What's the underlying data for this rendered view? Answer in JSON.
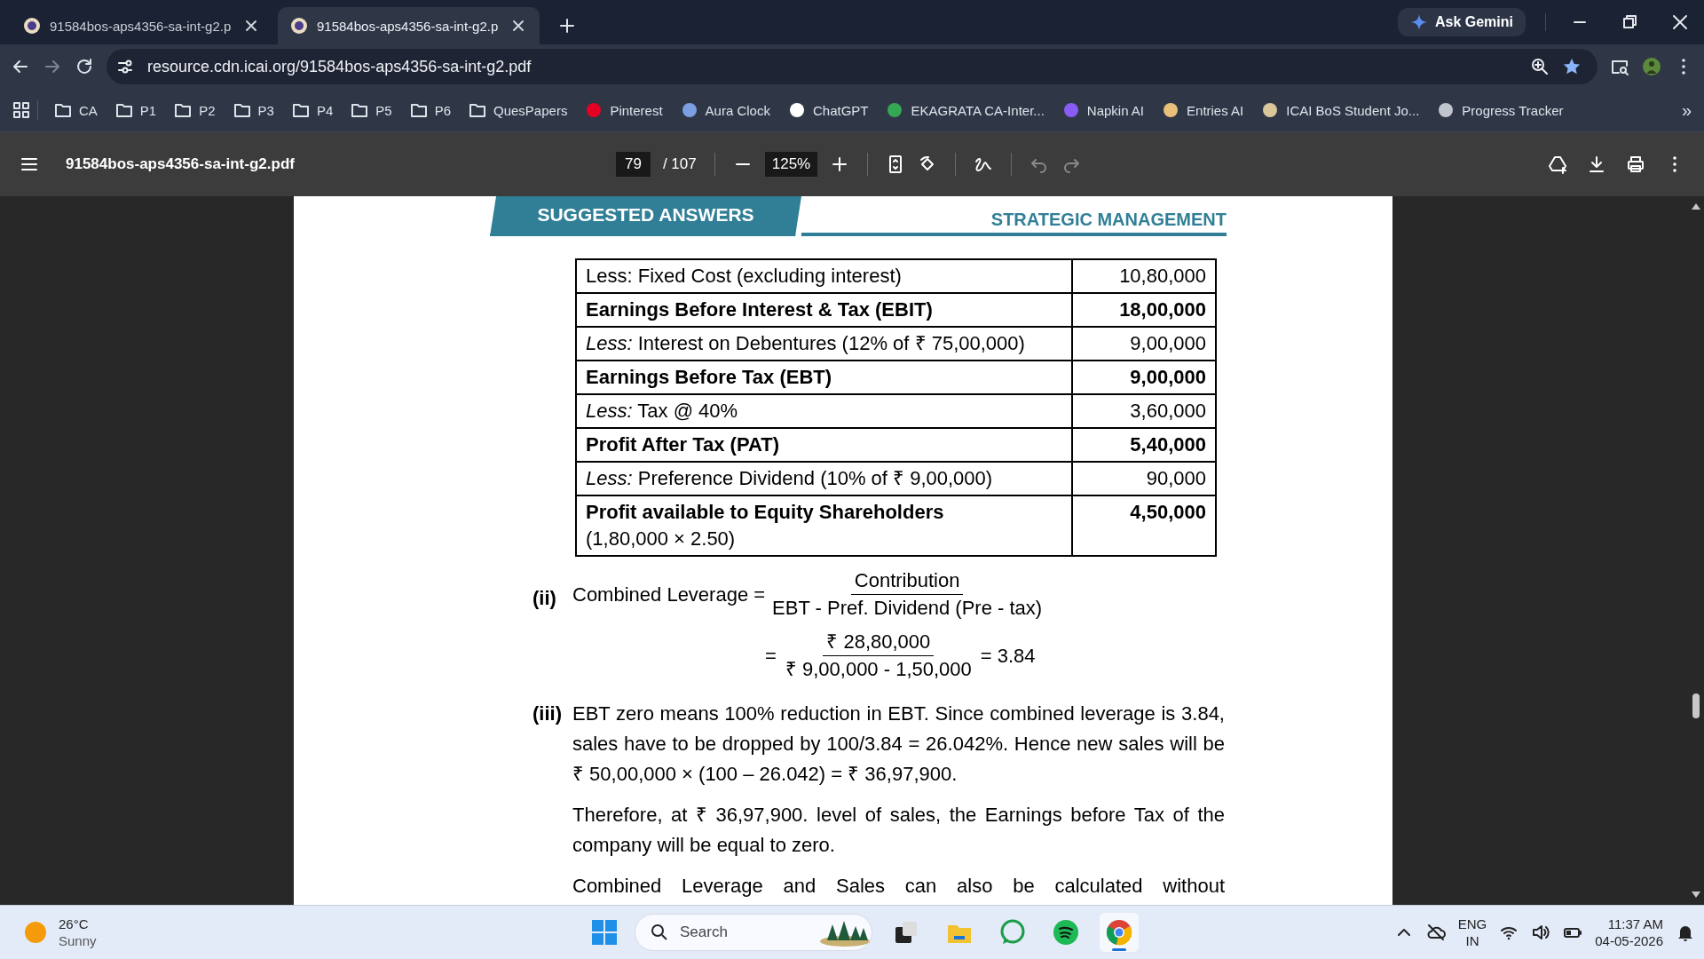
{
  "browser": {
    "tabs": [
      {
        "title": "91584bos-aps4356-sa-int-g2.p",
        "selected": false
      },
      {
        "title": "91584bos-aps4356-sa-int-g2.p",
        "selected": true
      }
    ],
    "ask_button": "Ask Gemini",
    "address": "resource.cdn.icai.org/91584bos-aps4356-sa-int-g2.pdf",
    "bookmarks": [
      {
        "kind": "folder",
        "label": "CA"
      },
      {
        "kind": "folder",
        "label": "P1"
      },
      {
        "kind": "folder",
        "label": "P2"
      },
      {
        "kind": "folder",
        "label": "P3"
      },
      {
        "kind": "folder",
        "label": "P4"
      },
      {
        "kind": "folder",
        "label": "P5"
      },
      {
        "kind": "folder",
        "label": "P6"
      },
      {
        "kind": "folder",
        "label": "QuesPapers"
      },
      {
        "kind": "site",
        "label": "Pinterest",
        "color": "#e60023"
      },
      {
        "kind": "site",
        "label": "Aura Clock",
        "color": "#7b9fe0"
      },
      {
        "kind": "site",
        "label": "ChatGPT",
        "color": "#ffffff"
      },
      {
        "kind": "site",
        "label": "EKAGRATA CA-Inter...",
        "color": "#34a853"
      },
      {
        "kind": "site",
        "label": "Napkin AI",
        "color": "#8a5cf6"
      },
      {
        "kind": "site",
        "label": "Entries AI",
        "color": "#e8c07a"
      },
      {
        "kind": "site",
        "label": "ICAI BoS Student Jo...",
        "color": "#d9c79a"
      },
      {
        "kind": "site",
        "label": "Progress Tracker",
        "color": "#c0c4cc"
      }
    ],
    "overflow": "»"
  },
  "viewer": {
    "filename": "91584bos-aps4356-sa-int-g2.pdf",
    "page": "79",
    "total": "/ 107",
    "zoom": "125%"
  },
  "document": {
    "header_left": "SUGGESTED ANSWERS",
    "header_right": "STRATEGIC MANAGEMENT",
    "table": {
      "rows": [
        {
          "bold": false,
          "label": "Less: Fixed Cost (excluding interest)",
          "value": "10,80,000"
        },
        {
          "bold": true,
          "label": "Earnings Before Interest & Tax (EBIT)",
          "value": "18,00,000"
        },
        {
          "bold": false,
          "label": "*Less:* Interest on Debentures (12% of ₹ 75,00,000)",
          "value": "9,00,000"
        },
        {
          "bold": true,
          "label": "Earnings Before Tax (EBT)",
          "value": "9,00,000"
        },
        {
          "bold": false,
          "label": "*Less:* Tax @ 40%",
          "value": "3,60,000"
        },
        {
          "bold": true,
          "label": "Profit After Tax (PAT)",
          "value": "5,40,000"
        },
        {
          "bold": false,
          "label": "*Less:* Preference Dividend (10% of ₹ 9,00,000)",
          "value": "90,000"
        },
        {
          "bold": true,
          "label": "Profit available to Equity Shareholders",
          "note": "(1,80,000 × 2.50)",
          "value": "4,50,000"
        }
      ]
    },
    "part_ii": {
      "label": "(ii)",
      "lead": "Combined Leverage =",
      "numerator": "Contribution",
      "denominator": "EBT - Pref. Dividend (Pre - tax)",
      "equals": "=",
      "numerator_2": "₹ 28,80,000",
      "denominator_2": "₹ 9,00,000 - 1,50,000",
      "result": "= 3.84"
    },
    "part_iii": {
      "label": "(iii)",
      "paragraphs": [
        {
          "kind": "full",
          "text": "EBT zero means 100% reduction in EBT. Since combined leverage is 3.84, sales have to be dropped by 100/3.84 = 26.042%.  Hence new sales will be ₹ 50,00,000 × (100 – 26.042) = ₹ 36,97,900."
        },
        {
          "kind": "full",
          "text": "Therefore, at ₹ 36,97,900. level of sales, the Earnings before Tax of the company will be equal to zero."
        },
        {
          "kind": "cut",
          "text": "Combined Leverage and Sales can also be calculated without"
        }
      ]
    }
  },
  "taskbar": {
    "temperature": "26°C",
    "weather": "Sunny",
    "search": "Search",
    "apps": [
      {
        "kind": "taskview",
        "active": false
      },
      {
        "kind": "files",
        "active": false
      },
      {
        "kind": "whatsapp",
        "active": false
      },
      {
        "kind": "spotify",
        "active": false
      },
      {
        "kind": "chrome",
        "active": true
      }
    ],
    "language": "ENG",
    "region": "IN",
    "time": "11:37 AM",
    "date": "04-05-2026"
  }
}
